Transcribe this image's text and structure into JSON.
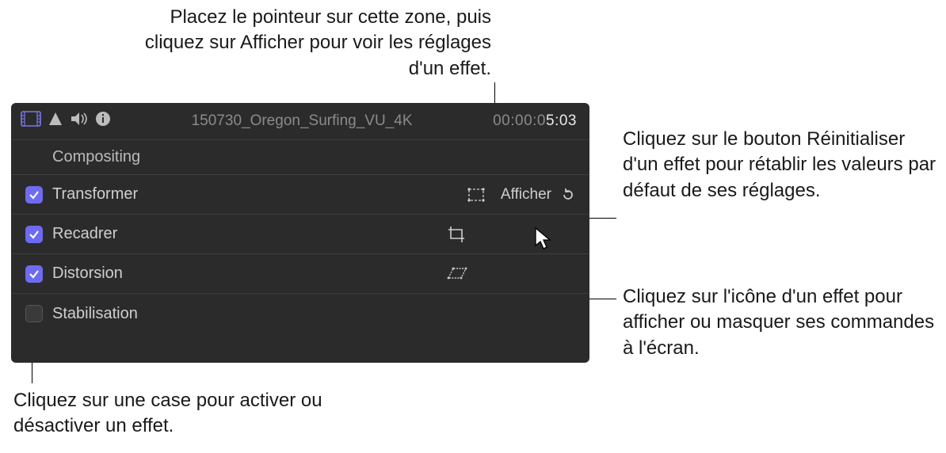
{
  "callouts": {
    "top": "Placez le pointeur sur cette zone, puis cliquez sur Afficher pour voir les réglages d'un effet.",
    "right1": "Cliquez sur le bouton Réinitialiser d'un effet pour rétablir les valeurs par défaut de ses réglages.",
    "right2": "Cliquez sur l'icône d'un effet pour afficher ou masquer ses commandes à l'écran.",
    "bottom": "Cliquez sur une case pour activer ou désactiver un effet."
  },
  "header": {
    "clip_name": "150730_Oregon_Surfing_VU_4K",
    "timecode_prefix": "00:00:0",
    "timecode_suffix": "5:03"
  },
  "section": {
    "label": "Compositing"
  },
  "effects": {
    "transform": {
      "label": "Transformer",
      "show_label": "Afficher"
    },
    "crop": {
      "label": "Recadrer"
    },
    "distort": {
      "label": "Distorsion"
    },
    "stabilize": {
      "label": "Stabilisation"
    }
  }
}
